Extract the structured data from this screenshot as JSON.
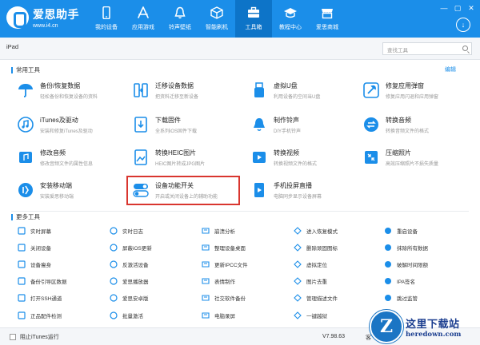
{
  "brand": {
    "name": "爱思助手",
    "url": "www.i4.cn"
  },
  "nav": [
    {
      "label": "我的设备",
      "icon": "phone-icon"
    },
    {
      "label": "应用游戏",
      "icon": "appstore-icon"
    },
    {
      "label": "铃声壁纸",
      "icon": "bell-icon"
    },
    {
      "label": "智能刷机",
      "icon": "box-icon"
    },
    {
      "label": "工具箱",
      "icon": "toolbox-icon",
      "active": true
    },
    {
      "label": "教程中心",
      "icon": "graduation-cap-icon"
    },
    {
      "label": "爱思商城",
      "icon": "store-icon"
    }
  ],
  "window_controls": [
    "—",
    "▢",
    "✕"
  ],
  "subbar": {
    "device": "iPad",
    "search_placeholder": "查找工具"
  },
  "sections": {
    "common": "常用工具",
    "more": "更多工具",
    "edit": "编辑"
  },
  "common_tools": [
    {
      "title": "备份/恢复数据",
      "desc": "轻松备份和恢复设备的资料",
      "icon": "umbrella-icon"
    },
    {
      "title": "迁移设备数据",
      "desc": "把资料迁移至新设备",
      "icon": "migrate-icon"
    },
    {
      "title": "虚拟U盘",
      "desc": "利用设备的空间当U盘",
      "icon": "usb-icon"
    },
    {
      "title": "修复应用弹窗",
      "desc": "修复应用闪退和应用弹窗",
      "icon": "wrench-icon"
    },
    {
      "title": "iTunes及驱动",
      "desc": "安装和修复iTunes及驱动",
      "icon": "music-icon"
    },
    {
      "title": "下载固件",
      "desc": "全系列iOS固件下载",
      "icon": "download-icon"
    },
    {
      "title": "制作铃声",
      "desc": "DIY手机铃声",
      "icon": "bell-make-icon"
    },
    {
      "title": "转换音频",
      "desc": "转换音频文件的格式",
      "icon": "convert-audio-icon"
    },
    {
      "title": "修改音频",
      "desc": "修改音频文件的属性信息",
      "icon": "edit-audio-icon"
    },
    {
      "title": "转换HEIC图片",
      "desc": "HEIC图片转成JPG图片",
      "icon": "heic-icon"
    },
    {
      "title": "转换视频",
      "desc": "转换视频文件的格式",
      "icon": "video-convert-icon"
    },
    {
      "title": "压缩照片",
      "desc": "高效压缩照片不损失质量",
      "icon": "compress-icon"
    },
    {
      "title": "安装移动端",
      "desc": "安装爱思移动端",
      "icon": "mobile-install-icon"
    },
    {
      "title": "设备功能开关",
      "desc": "开启或关闭设备上的辅助功能",
      "icon": "toggle-icon"
    },
    {
      "title": "手机投屏直播",
      "desc": "电脑同步显示设备屏幕",
      "icon": "screencast-icon"
    }
  ],
  "more_tools": [
    {
      "label": "实时屏幕",
      "icon": "screen-icon"
    },
    {
      "label": "实时日志",
      "icon": "log-icon"
    },
    {
      "label": "崩溃分析",
      "icon": "crash-icon"
    },
    {
      "label": "进入恢复模式",
      "icon": "recovery-icon"
    },
    {
      "label": "重启设备",
      "icon": "restart-icon"
    },
    {
      "label": "关闭设备",
      "icon": "power-icon"
    },
    {
      "label": "屏蔽iOS更新",
      "icon": "block-update-icon"
    },
    {
      "label": "整理设备桌面",
      "icon": "desktop-icon"
    },
    {
      "label": "删除顽固图标",
      "icon": "delete-icon"
    },
    {
      "label": "抹除所有数据",
      "icon": "erase-icon"
    },
    {
      "label": "设备瘦身",
      "icon": "slim-icon"
    },
    {
      "label": "反激活设备",
      "icon": "deactivate-icon"
    },
    {
      "label": "更新IPCC文件",
      "icon": "ipcc-icon"
    },
    {
      "label": "虚拟定位",
      "icon": "location-icon"
    },
    {
      "label": "破解时间限额",
      "icon": "time-icon"
    },
    {
      "label": "备份引导区数据",
      "icon": "boot-icon"
    },
    {
      "label": "爱思播放器",
      "icon": "player-icon"
    },
    {
      "label": "表情制作",
      "icon": "emoji-icon"
    },
    {
      "label": "图片去重",
      "icon": "dedupe-icon"
    },
    {
      "label": "IPA签名",
      "icon": "ipa-icon"
    },
    {
      "label": "打开SSH通道",
      "icon": "ssh-icon"
    },
    {
      "label": "爱思安卓版",
      "icon": "android-icon"
    },
    {
      "label": "社交软件备份",
      "icon": "social-icon"
    },
    {
      "label": "管理描述文件",
      "icon": "profile-icon"
    },
    {
      "label": "跳过监管",
      "icon": "skip-icon"
    },
    {
      "label": "正品配件检测",
      "icon": "accessory-icon"
    },
    {
      "label": "批量激活",
      "icon": "batch-icon"
    },
    {
      "label": "电脑录屏",
      "icon": "record-icon"
    },
    {
      "label": "一键越狱",
      "icon": "jailbreak-icon"
    },
    {
      "label": "",
      "icon": "extra-icon"
    }
  ],
  "footer": {
    "itunes_label": "阻止iTunes运行",
    "version": "V7.98.63",
    "extra": "客"
  },
  "watermark": {
    "badge": "Z",
    "cn": "这里下载站",
    "url": "heredown.com"
  },
  "colors": {
    "brand": "#1b8ee9",
    "highlight": "#d9362f"
  }
}
